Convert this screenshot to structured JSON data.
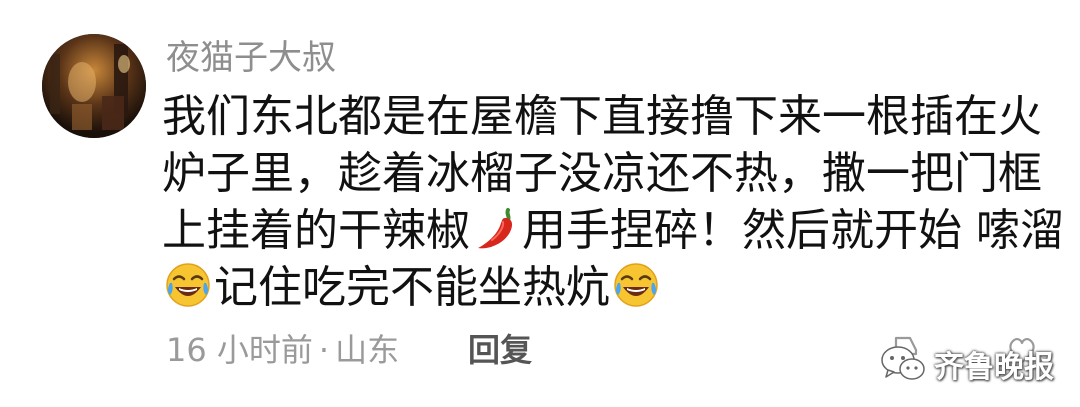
{
  "comment": {
    "username": "夜猫子大叔",
    "lines": [
      "我们东北都是在屋檐下直接撸下来一根插在火",
      "炉子里，趁着冰榴子没凉还不热，撒一把门框",
      "上挂着的干辣椒",
      "用手捏碎！然后就开始 嗦溜",
      "记住吃完不能坐热炕"
    ],
    "time": "16 小时前",
    "separator": "·",
    "location": "山东",
    "reply_label": "回复"
  },
  "watermark": {
    "text": "齐鲁晚报",
    "icon": "wechat-icon"
  },
  "icons": {
    "chili": "chili-pepper-emoji",
    "laugh": "laughing-tears-emoji",
    "dislike": "dislike-icon",
    "like": "like-icon"
  }
}
